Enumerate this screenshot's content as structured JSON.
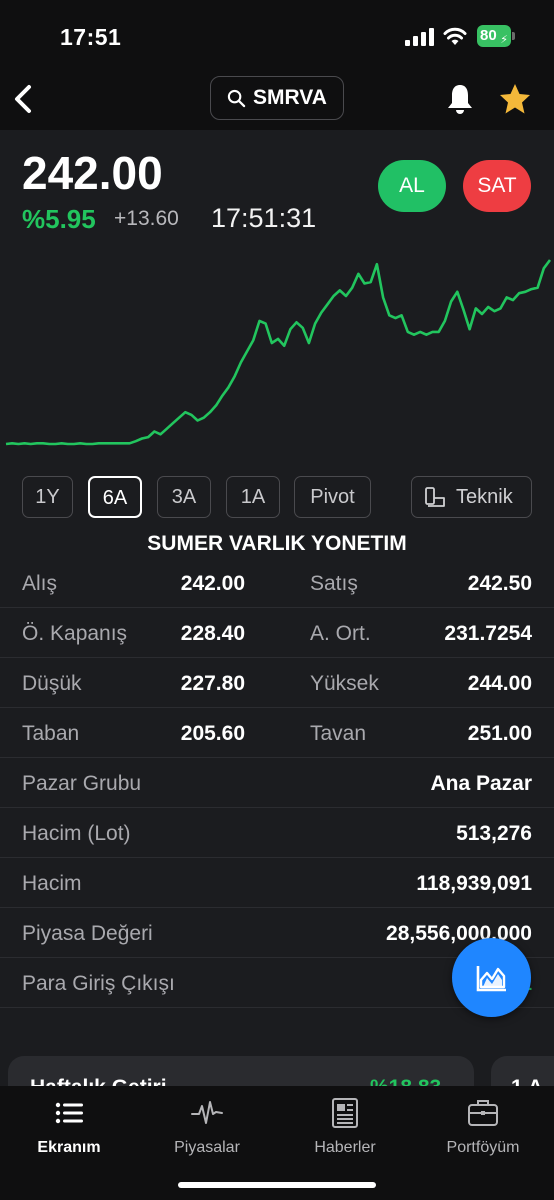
{
  "status": {
    "time": "17:51",
    "battery": "80"
  },
  "header": {
    "search_ticker": "SMRVA"
  },
  "quote": {
    "price": "242.00",
    "change_pct": "%5.95",
    "change_abs": "+13.60",
    "time": "17:51:31",
    "buy_label": "AL",
    "sell_label": "SAT"
  },
  "colors": {
    "up": "#22c55e",
    "buy": "#21c065",
    "sell": "#ee3d42",
    "accent": "#1f86ff"
  },
  "chart_data": {
    "type": "line",
    "values": [
      205,
      205.5,
      205,
      205.5,
      205,
      205.5,
      205.5,
      205,
      205,
      205.5,
      205,
      205,
      205.5,
      205,
      205,
      205.5,
      205.5,
      205.5,
      205.5,
      205.5,
      205.5,
      207,
      209,
      210,
      214,
      212,
      216,
      220,
      224,
      228,
      226,
      222,
      224,
      228,
      233,
      240,
      246,
      254,
      264,
      272,
      280,
      294,
      292,
      278,
      281,
      276,
      288,
      293,
      289,
      278,
      292,
      300,
      306,
      312,
      316,
      312,
      318,
      328,
      321,
      322,
      335,
      311,
      298,
      296,
      298,
      286,
      284,
      286,
      284,
      286,
      286,
      294,
      308,
      315,
      302,
      288,
      303,
      299,
      304,
      301,
      303,
      311,
      309,
      314,
      315,
      317,
      318,
      332,
      338
    ],
    "series_color": "#22c55e"
  },
  "ranges": [
    {
      "label": "1Y",
      "active": false
    },
    {
      "label": "6A",
      "active": true
    },
    {
      "label": "3A",
      "active": false
    },
    {
      "label": "1A",
      "active": false
    },
    {
      "label": "Pivot",
      "active": false
    }
  ],
  "teknik_label": "Teknik",
  "company_name": "SUMER VARLIK YONETIM",
  "pair_rows": [
    {
      "l1": "Alış",
      "v1": "242.00",
      "l2": "Satış",
      "v2": "242.50"
    },
    {
      "l1": "Ö. Kapanış",
      "v1": "228.40",
      "l2": "A. Ort.",
      "v2": "231.7254"
    },
    {
      "l1": "Düşük",
      "v1": "227.80",
      "l2": "Yüksek",
      "v2": "244.00"
    },
    {
      "l1": "Taban",
      "v1": "205.60",
      "l2": "Tavan",
      "v2": "251.00"
    }
  ],
  "single_rows": [
    {
      "label": "Pazar Grubu",
      "value": "Ana Pazar"
    },
    {
      "label": "Hacim (Lot)",
      "value": "513,276"
    },
    {
      "label": "Hacim",
      "value": "118,939,091"
    },
    {
      "label": "Piyasa Değeri",
      "value": "28,556,000,000"
    },
    {
      "label": "Para Giriş Çıkışı",
      "value": "14,1"
    }
  ],
  "cards": [
    {
      "title": "Haftalık Getiri",
      "value": "%18.83"
    },
    {
      "title": "1 A"
    }
  ],
  "tabs": [
    {
      "label": "Ekranım",
      "icon": "list-icon",
      "active": true
    },
    {
      "label": "Piyasalar",
      "icon": "pulse-icon",
      "active": false
    },
    {
      "label": "Haberler",
      "icon": "newspaper-icon",
      "active": false
    },
    {
      "label": "Portföyüm",
      "icon": "briefcase-icon",
      "active": false
    }
  ]
}
